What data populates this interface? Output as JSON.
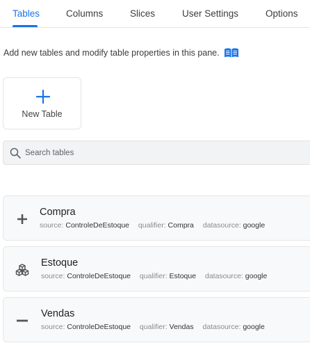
{
  "tabs": [
    {
      "label": "Tables",
      "active": true
    },
    {
      "label": "Columns",
      "active": false
    },
    {
      "label": "Slices",
      "active": false
    },
    {
      "label": "User Settings",
      "active": false
    },
    {
      "label": "Options",
      "active": false
    }
  ],
  "intro_text": "Add new tables and modify table properties in this pane.",
  "new_table_label": "New Table",
  "search": {
    "placeholder": "Search tables",
    "value": ""
  },
  "meta_labels": {
    "source": "source:",
    "qualifier": "qualifier:",
    "datasource": "datasource:"
  },
  "tables": [
    {
      "name": "Compra",
      "icon": "plus-icon",
      "source": "ControleDeEstoque",
      "qualifier": "Compra",
      "datasource": "google"
    },
    {
      "name": "Estoque",
      "icon": "boxes-icon",
      "source": "ControleDeEstoque",
      "qualifier": "Estoque",
      "datasource": "google"
    },
    {
      "name": "Vendas",
      "icon": "minus-icon",
      "source": "ControleDeEstoque",
      "qualifier": "Vendas",
      "datasource": "google"
    }
  ],
  "colors": {
    "accent": "#1a73e8",
    "text": "#202124",
    "muted": "#8a8a8a",
    "card_bg": "#f8f9fa"
  }
}
